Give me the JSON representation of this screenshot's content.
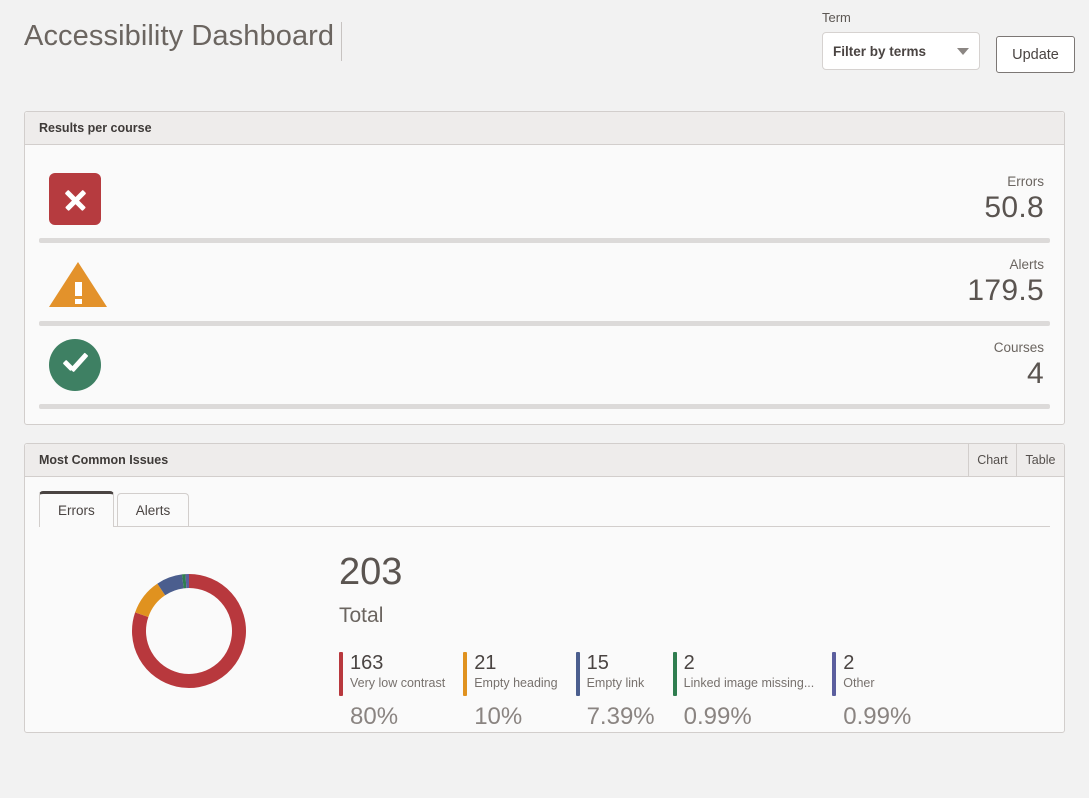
{
  "header": {
    "title": "Accessibility Dashboard",
    "term_label": "Term",
    "term_value": "Filter by terms",
    "term_placeholder": "Filter by terms",
    "update_label": "Update"
  },
  "results_panel": {
    "title": "Results per course",
    "rows": [
      {
        "icon": "error-x-icon",
        "label": "Errors",
        "value": "50.8"
      },
      {
        "icon": "alert-triangle-icon",
        "label": "Alerts",
        "value": "179.5"
      },
      {
        "icon": "success-check-icon",
        "label": "Courses",
        "value": "4"
      }
    ]
  },
  "issues_panel": {
    "title": "Most Common Issues",
    "view_buttons": [
      {
        "label": "Chart",
        "active": true
      },
      {
        "label": "Table",
        "active": false
      }
    ],
    "tabs": [
      {
        "label": "Errors",
        "active": true
      },
      {
        "label": "Alerts",
        "active": false
      }
    ]
  },
  "chart_data": {
    "type": "pie",
    "title": "Most Common Issues",
    "subtype": "donut",
    "total": "203",
    "total_label": "Total",
    "legend_position": "right",
    "categories": [
      "Very low contrast",
      "Empty heading",
      "Empty link",
      "Linked image missing...",
      "Other"
    ],
    "values": [
      163,
      21,
      15,
      2,
      2
    ],
    "count_labels": [
      "163",
      "21",
      "15",
      "2",
      "2"
    ],
    "percent_labels": [
      "80%",
      "10%",
      "7.39%",
      "0.99%",
      "0.99%"
    ],
    "percents": [
      80,
      10,
      7.39,
      0.99,
      0.99
    ],
    "colors": [
      "#B8383D",
      "#E0921F",
      "#4B5E8E",
      "#2F7D4F",
      "#5B5E9E"
    ]
  },
  "palette": {
    "error_red": "#B63B3F",
    "alert_orange": "#E3922B",
    "success_green": "#3E8063",
    "page_bg": "#F2F2F2",
    "panel_bg": "#FAFAFA",
    "panel_head_bg": "#EEECEB",
    "border": "#D2CECC",
    "text": "#4A4442"
  }
}
